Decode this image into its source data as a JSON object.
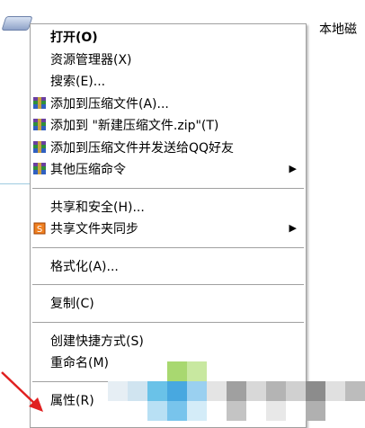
{
  "desktop": {
    "drive_label": "本地磁"
  },
  "menu": {
    "items": [
      {
        "label": "打开(O)",
        "bold": true
      },
      {
        "label": "资源管理器(X)"
      },
      {
        "label": "搜索(E)..."
      },
      {
        "label": "添加到压缩文件(A)...",
        "icon": "winrar-icon"
      },
      {
        "label": "添加到 \"新建压缩文件.zip\"(T)",
        "icon": "winrar-icon"
      },
      {
        "label": "添加到压缩文件并发送给QQ好友",
        "icon": "winrar-icon"
      },
      {
        "label": "其他压缩命令",
        "icon": "winrar-icon",
        "submenu": true
      },
      {
        "label": "共享和安全(H)..."
      },
      {
        "label": "共享文件夹同步",
        "icon": "sync-icon",
        "submenu": true
      },
      {
        "label": "格式化(A)..."
      },
      {
        "label": "复制(C)"
      },
      {
        "label": "创建快捷方式(S)"
      },
      {
        "label": "重命名(M)"
      },
      {
        "label": "属性(R)"
      }
    ]
  },
  "colors": {
    "menu_border": "#a0a0a0",
    "arrow": "#e02020",
    "accent": "#3a8fd0"
  }
}
